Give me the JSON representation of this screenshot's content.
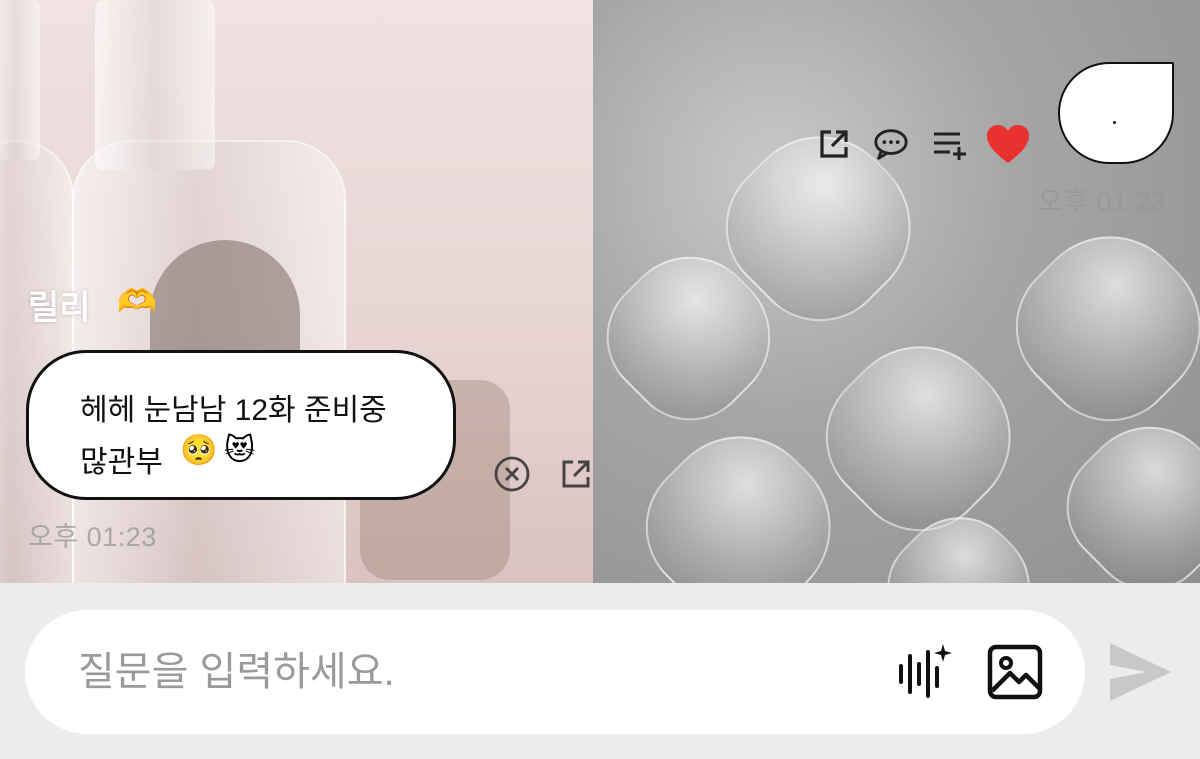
{
  "chat": {
    "sender_name": "릴리",
    "sender_emoji": "🫶",
    "message_line_1": "헤헤 눈남남 12화 준비중",
    "message_line_2": "많관부",
    "message_emoji_1": "🥺",
    "message_emoji_2": "😻",
    "received_time": "오후 01:23",
    "sent_time": "오후 01:23"
  },
  "actions": {
    "share": "share-icon",
    "comment": "comment-icon",
    "add_to_list": "add-to-list-icon",
    "like": "heart-icon",
    "like_color": "#e8322f"
  },
  "message_actions": {
    "delete": "close-circle-icon",
    "share": "share-icon"
  },
  "composer": {
    "placeholder": "질문을 입력하세요.",
    "value": "",
    "voice_icon": "voice-sparkle-icon",
    "image_icon": "image-icon",
    "send_icon": "send-icon",
    "send_color": "#c8c8c8"
  }
}
